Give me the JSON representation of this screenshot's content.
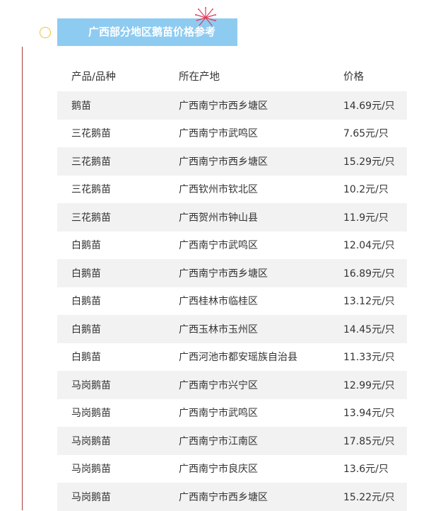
{
  "title": "广西部分地区鹅苗价格参考",
  "colors": {
    "title_bar": "#8ecbf1",
    "title_text": "#ffffff",
    "row_shade": "#f2f2f2",
    "left_rule": "#a83a3a",
    "circle": "#e8c43a",
    "burst": "#e23a5a"
  },
  "icons": {
    "circle": "circle-icon",
    "burst": "firework-icon"
  },
  "table": {
    "headers": [
      "产品/品种",
      "所在产地",
      "价格"
    ],
    "rows": [
      [
        "鹅苗",
        "广西南宁市西乡塘区",
        "14.69元/只"
      ],
      [
        "三花鹅苗",
        "广西南宁市武鸣区",
        "7.65元/只"
      ],
      [
        "三花鹅苗",
        "广西南宁市西乡塘区",
        "15.29元/只"
      ],
      [
        "三花鹅苗",
        "广西钦州市钦北区",
        "10.2元/只"
      ],
      [
        "三花鹅苗",
        "广西贺州市钟山县",
        "11.9元/只"
      ],
      [
        "白鹅苗",
        "广西南宁市武鸣区",
        "12.04元/只"
      ],
      [
        "白鹅苗",
        "广西南宁市西乡塘区",
        "16.89元/只"
      ],
      [
        "白鹅苗",
        "广西桂林市临桂区",
        "13.12元/只"
      ],
      [
        "白鹅苗",
        "广西玉林市玉州区",
        "14.45元/只"
      ],
      [
        "白鹅苗",
        "广西河池市都安瑶族自治县",
        "11.33元/只"
      ],
      [
        "马岗鹅苗",
        "广西南宁市兴宁区",
        "12.99元/只"
      ],
      [
        "马岗鹅苗",
        "广西南宁市武鸣区",
        "13.94元/只"
      ],
      [
        "马岗鹅苗",
        "广西南宁市江南区",
        "17.85元/只"
      ],
      [
        "马岗鹅苗",
        "广西南宁市良庆区",
        "13.6元/只"
      ],
      [
        "马岗鹅苗",
        "广西南宁市西乡塘区",
        "15.22元/只"
      ]
    ]
  }
}
